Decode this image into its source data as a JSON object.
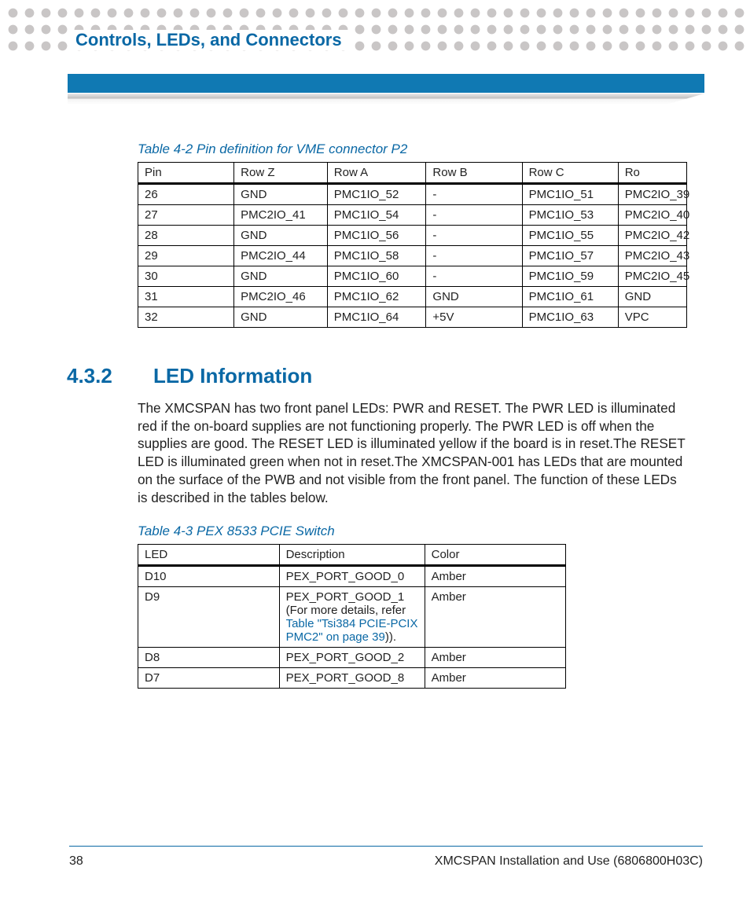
{
  "header": {
    "chapter_title": "Controls, LEDs, and Connectors"
  },
  "table42": {
    "caption": "Table 4-2 Pin definition for VME connector P2",
    "headers": [
      "Pin",
      "Row Z",
      "Row A",
      "Row B",
      "Row C",
      "Ro"
    ],
    "rows": [
      [
        "26",
        "GND",
        "PMC1IO_52",
        "-",
        "PMC1IO_51",
        "PMC2IO_39"
      ],
      [
        "27",
        "PMC2IO_41",
        "PMC1IO_54",
        "-",
        "PMC1IO_53",
        "PMC2IO_40"
      ],
      [
        "28",
        "GND",
        "PMC1IO_56",
        "-",
        "PMC1IO_55",
        "PMC2IO_42"
      ],
      [
        "29",
        "PMC2IO_44",
        "PMC1IO_58",
        "-",
        "PMC1IO_57",
        "PMC2IO_43"
      ],
      [
        "30",
        "GND",
        "PMC1IO_60",
        "-",
        "PMC1IO_59",
        "PMC2IO_45"
      ],
      [
        "31",
        "PMC2IO_46",
        "PMC1IO_62",
        "GND",
        "PMC1IO_61",
        "GND"
      ],
      [
        "32",
        "GND",
        "PMC1IO_64",
        "+5V",
        "PMC1IO_63",
        "VPC"
      ]
    ]
  },
  "section": {
    "number": "4.3.2",
    "title": "LED Information",
    "body": "The XMCSPAN has two front panel LEDs: PWR and RESET. The PWR LED is illuminated red if the on-board supplies are not functioning properly. The PWR LED is off when the supplies are good. The RESET LED is illuminated yellow if the board is in reset.The RESET LED is illuminated green when not in reset.The XMCSPAN-001 has LEDs that are mounted on the surface of the PWB and not visible from the front panel. The function of these LEDs is described in the tables below."
  },
  "table43": {
    "caption": "Table 4-3 PEX 8533 PCIE Switch",
    "headers": [
      "LED",
      "Description",
      "Color"
    ],
    "rows": [
      {
        "led": "D10",
        "desc_pre": "PEX_PORT_GOOD_0",
        "xref": "",
        "desc_post": "",
        "color": "Amber"
      },
      {
        "led": "D9",
        "desc_pre": "PEX_PORT_GOOD_1 (For more details, refer ",
        "xref": "Table \"Tsi384 PCIE-PCIX PMC2\" on page 39",
        "desc_post": ")).",
        "color": "Amber"
      },
      {
        "led": "D8",
        "desc_pre": "PEX_PORT_GOOD_2",
        "xref": "",
        "desc_post": "",
        "color": "Amber"
      },
      {
        "led": "D7",
        "desc_pre": "PEX_PORT_GOOD_8",
        "xref": "",
        "desc_post": "",
        "color": "Amber"
      }
    ]
  },
  "footer": {
    "page": "38",
    "doc": "XMCSPAN Installation and Use (6806800H03C)"
  }
}
